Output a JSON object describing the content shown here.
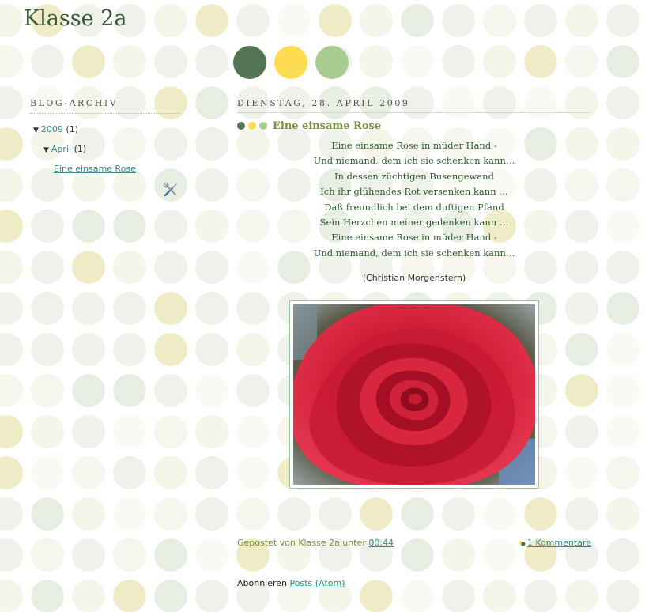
{
  "blog": {
    "title": "Klasse 2a"
  },
  "theme_colors": {
    "dark_green": "#537452",
    "yellow": "#fddc51",
    "light_green": "#a7cb91",
    "link": "#3a8a8a",
    "title_olive": "#7a8f3e",
    "poem_green": "#2d5a2d"
  },
  "sidebar": {
    "heading": "BLOG-ARCHIV",
    "archive": {
      "year": {
        "label": "2009",
        "count": "(1)"
      },
      "month": {
        "label": "April",
        "count": "(1)"
      },
      "post": {
        "label": "Eine einsame Rose"
      }
    },
    "icon": "wrench-screwdriver-icon"
  },
  "post": {
    "date": "DIENSTAG, 28. APRIL 2009",
    "title": "Eine einsame Rose",
    "poem_lines": [
      "Eine einsame Rose in müder Hand -",
      "Und niemand, dem ich sie schenken kann…",
      "In dessen züchtigen Busengewand",
      "Ich ihr glühendes Rot versenken kann …",
      "Daß freundlich bei dem duftigen Pfand",
      "Sein Herzchen meiner gedenken kann …",
      "Eine einsame Rose in müder Hand -",
      "Und niemand, dem ich sie schenken kann…"
    ],
    "author": "(Christian Morgenstern)",
    "footer": {
      "posted_by": "Gepostet von Klasse 2a unter",
      "time": "00:44",
      "comments": "1 Kommentare",
      "comment_icon": "comment-icon"
    }
  },
  "subscribe": {
    "label": "Abonnieren",
    "link": "Posts (Atom)"
  }
}
